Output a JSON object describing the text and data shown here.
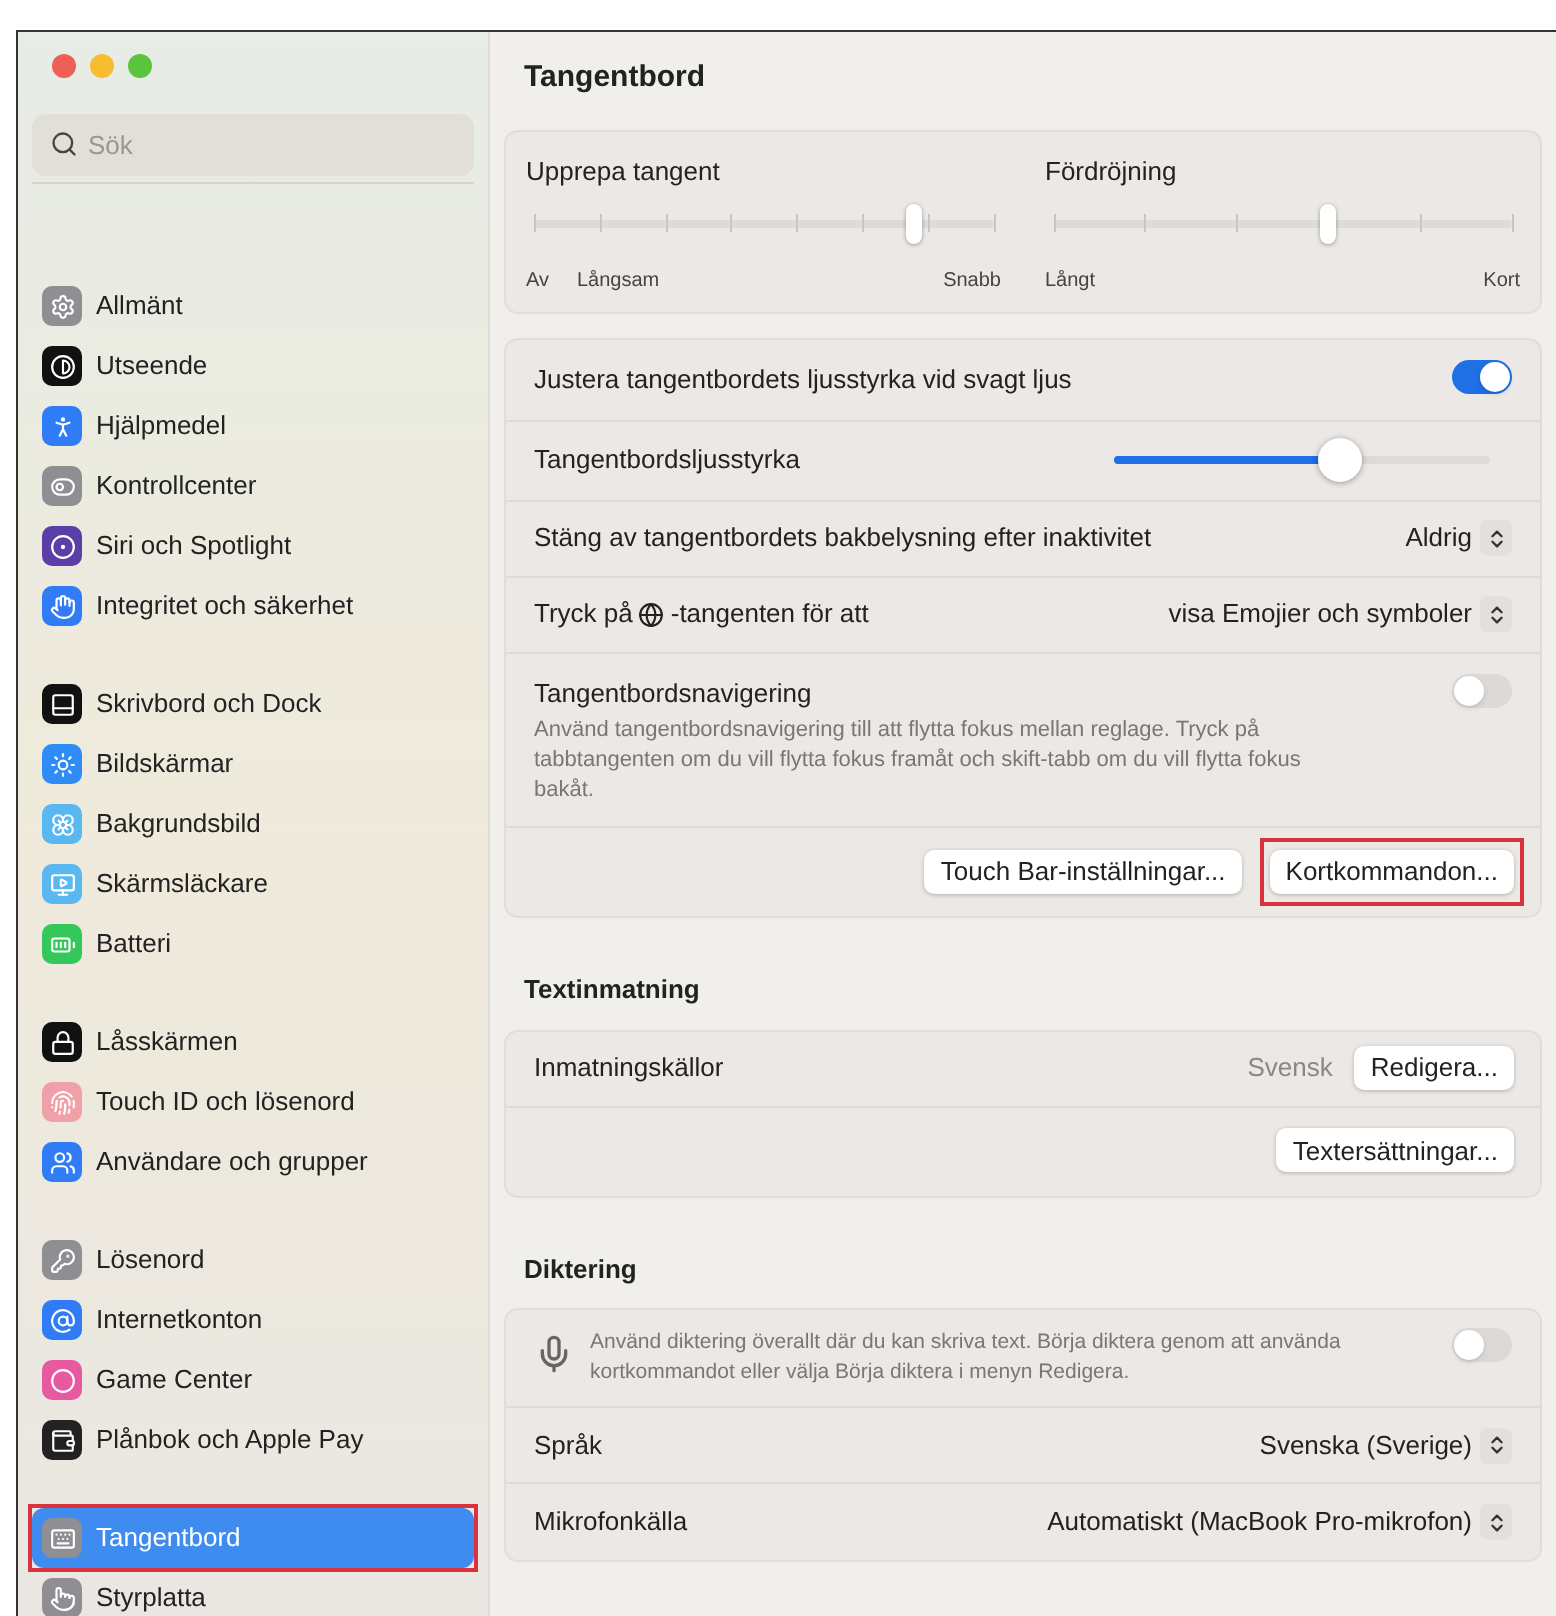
{
  "window": {
    "traffic_lights": [
      {
        "color": "#ee5f57"
      },
      {
        "color": "#f5bd2f"
      },
      {
        "color": "#5ac53c"
      }
    ]
  },
  "sidebar": {
    "search": {
      "placeholder": "Sök"
    },
    "groups": [
      {
        "items": [
          {
            "label": "Allmänt",
            "selected": false,
            "highlighted": false
          },
          {
            "label": "Utseende",
            "selected": false,
            "highlighted": false
          },
          {
            "label": "Hjälpmedel",
            "selected": false,
            "highlighted": false
          },
          {
            "label": "Kontrollcenter",
            "selected": false,
            "highlighted": false
          },
          {
            "label": "Siri och Spotlight",
            "selected": false,
            "highlighted": false
          },
          {
            "label": "Integritet och säkerhet",
            "selected": false,
            "highlighted": false
          }
        ]
      },
      {
        "items": [
          {
            "label": "Skrivbord och Dock",
            "selected": false,
            "highlighted": false
          },
          {
            "label": "Bildskärmar",
            "selected": false,
            "highlighted": false
          },
          {
            "label": "Bakgrundsbild",
            "selected": false,
            "highlighted": false
          },
          {
            "label": "Skärmsläckare",
            "selected": false,
            "highlighted": false
          },
          {
            "label": "Batteri",
            "selected": false,
            "highlighted": false
          }
        ]
      },
      {
        "items": [
          {
            "label": "Låsskärmen",
            "selected": false,
            "highlighted": false
          },
          {
            "label": "Touch ID och lösenord",
            "selected": false,
            "highlighted": false
          },
          {
            "label": "Användare och grupper",
            "selected": false,
            "highlighted": false
          }
        ]
      },
      {
        "items": [
          {
            "label": "Lösenord",
            "selected": false,
            "highlighted": false
          },
          {
            "label": "Internetkonton",
            "selected": false,
            "highlighted": false
          },
          {
            "label": "Game Center",
            "selected": false,
            "highlighted": false
          },
          {
            "label": "Plånbok och Apple Pay",
            "selected": false,
            "highlighted": false
          }
        ]
      },
      {
        "items": [
          {
            "label": "Tangentbord",
            "selected": true,
            "highlighted": true
          },
          {
            "label": "Styrplatta",
            "selected": false,
            "highlighted": false
          }
        ]
      }
    ]
  },
  "page": {
    "title": "Tangentbord",
    "sliders": [
      {
        "label": "Upprepa tangent",
        "level": 0.83,
        "marks": [
          "Av",
          "Långsam",
          "Snabb"
        ]
      },
      {
        "label": "Fördröjning",
        "level": 0.6,
        "marks": [
          "Långt",
          "Kort"
        ]
      }
    ],
    "settings": [
      {
        "kind": "toggle",
        "label": "Justera tangentbordets ljusstyrka vid svagt ljus",
        "on": true
      },
      {
        "kind": "slider",
        "label": "Tangentbordsljusstyrka",
        "level": 0.6
      },
      {
        "kind": "select",
        "label": "Stäng av tangentbordets bakbelysning efter inaktivitet",
        "value": "Aldrig"
      },
      {
        "kind": "globe-select",
        "label_before": "Tryck på",
        "label_after": "-tangenten för att",
        "value": "visa Emojier och symboler"
      },
      {
        "kind": "toggle",
        "label": "Tangentbordsnavigering",
        "description": "Använd tangentbordsnavigering till att flytta fokus mellan reglage. Tryck på tabbtangenten om du vill flytta fokus framåt och skift-tabb om du vill flytta fokus bakåt.",
        "on": false
      },
      {
        "kind": "buttons",
        "buttons": [
          {
            "label": "Touch Bar-inställningar...",
            "highlighted": false
          },
          {
            "label": "Kortkommandon...",
            "highlighted": true
          }
        ]
      }
    ],
    "sections": [
      {
        "title": "Textinmatning",
        "rows": [
          {
            "kind": "value-button",
            "label": "Inmatningskällor",
            "value": "Svensk",
            "button": "Redigera..."
          },
          {
            "kind": "buttons",
            "buttons": [
              {
                "label": "Textersättningar...",
                "highlighted": false
              }
            ]
          }
        ]
      },
      {
        "title": "Diktering",
        "rows": [
          {
            "kind": "mic-toggle",
            "description": "Använd diktering överallt där du kan skriva text. Börja diktera genom att använda kortkommandot eller välja Börja diktera i menyn Redigera.",
            "on": false
          },
          {
            "kind": "select",
            "label": "Språk",
            "value": "Svenska (Sverige)"
          },
          {
            "kind": "select",
            "label": "Mikrofonkälla",
            "value": "Automatiskt (MacBook Pro-mikrofon)"
          }
        ]
      }
    ]
  }
}
